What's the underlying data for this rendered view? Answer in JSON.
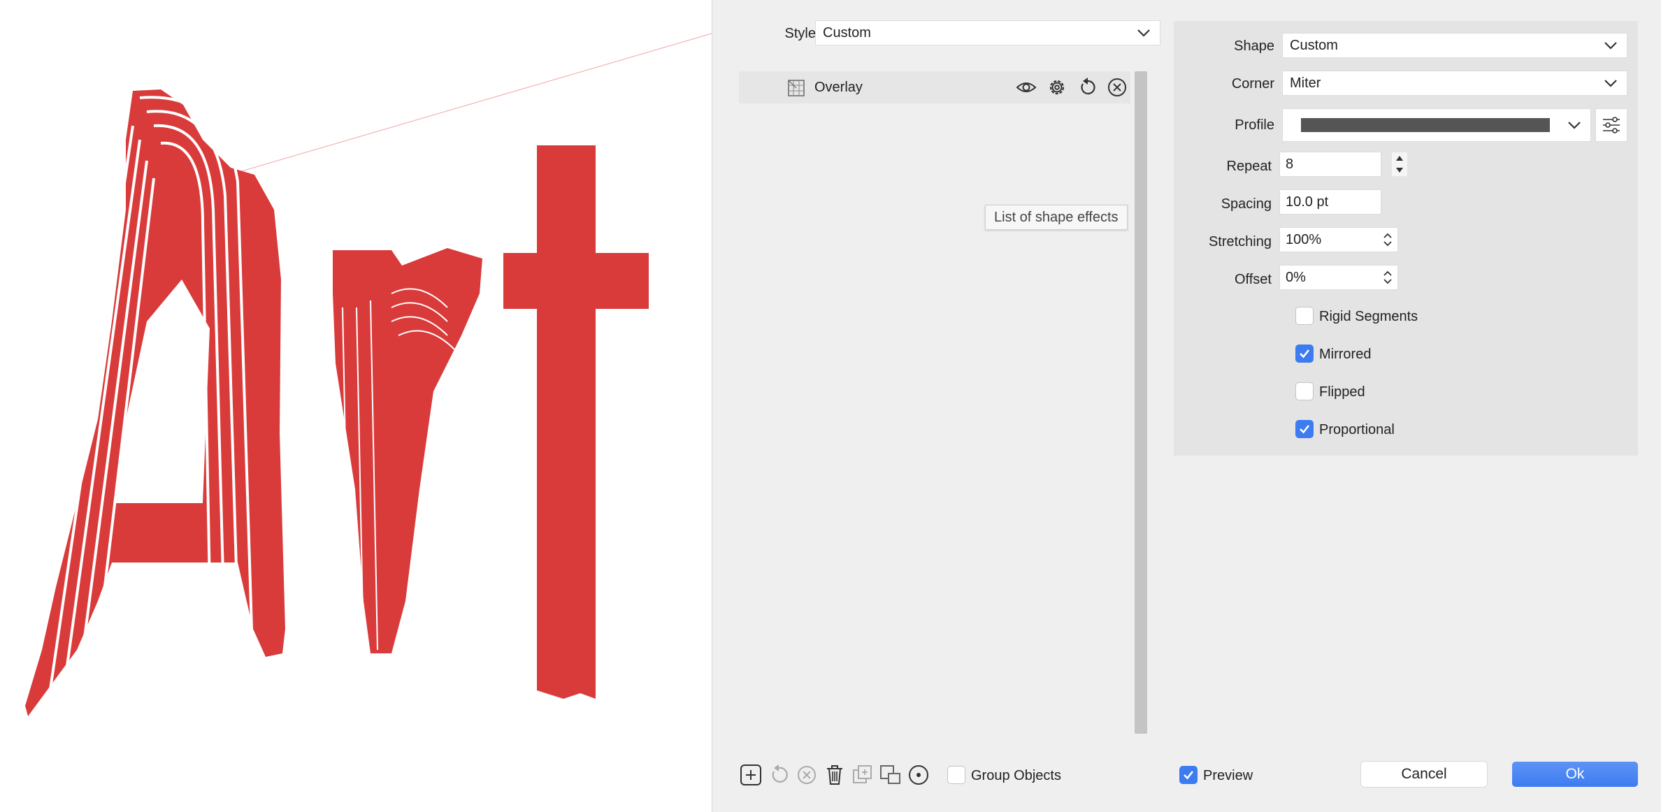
{
  "styles": {
    "label": "Styles",
    "value": "Custom"
  },
  "effects_list": {
    "items": [
      {
        "name": "Overlay"
      }
    ],
    "tooltip": "List of shape effects"
  },
  "props": {
    "shape": {
      "label": "Shape",
      "value": "Custom"
    },
    "corner": {
      "label": "Corner",
      "value": "Miter"
    },
    "profile": {
      "label": "Profile"
    },
    "repeat": {
      "label": "Repeat",
      "value": "8"
    },
    "spacing": {
      "label": "Spacing",
      "value": "10.0 pt"
    },
    "stretching": {
      "label": "Stretching",
      "value": "100%"
    },
    "offset": {
      "label": "Offset",
      "value": "0%"
    },
    "rigid_segments": {
      "label": "Rigid Segments",
      "checked": false
    },
    "mirrored": {
      "label": "Mirrored",
      "checked": true
    },
    "flipped": {
      "label": "Flipped",
      "checked": false
    },
    "proportional": {
      "label": "Proportional",
      "checked": true
    }
  },
  "footer": {
    "group_objects": {
      "label": "Group Objects",
      "checked": false
    },
    "preview": {
      "label": "Preview",
      "checked": true
    },
    "cancel_label": "Cancel",
    "ok_label": "Ok"
  },
  "colors": {
    "art_red": "#d93b3b",
    "accent_blue": "#3d7cf0",
    "panel_bg": "#efefef",
    "props_bg": "#e4e4e4",
    "profile_bar": "#555555"
  }
}
